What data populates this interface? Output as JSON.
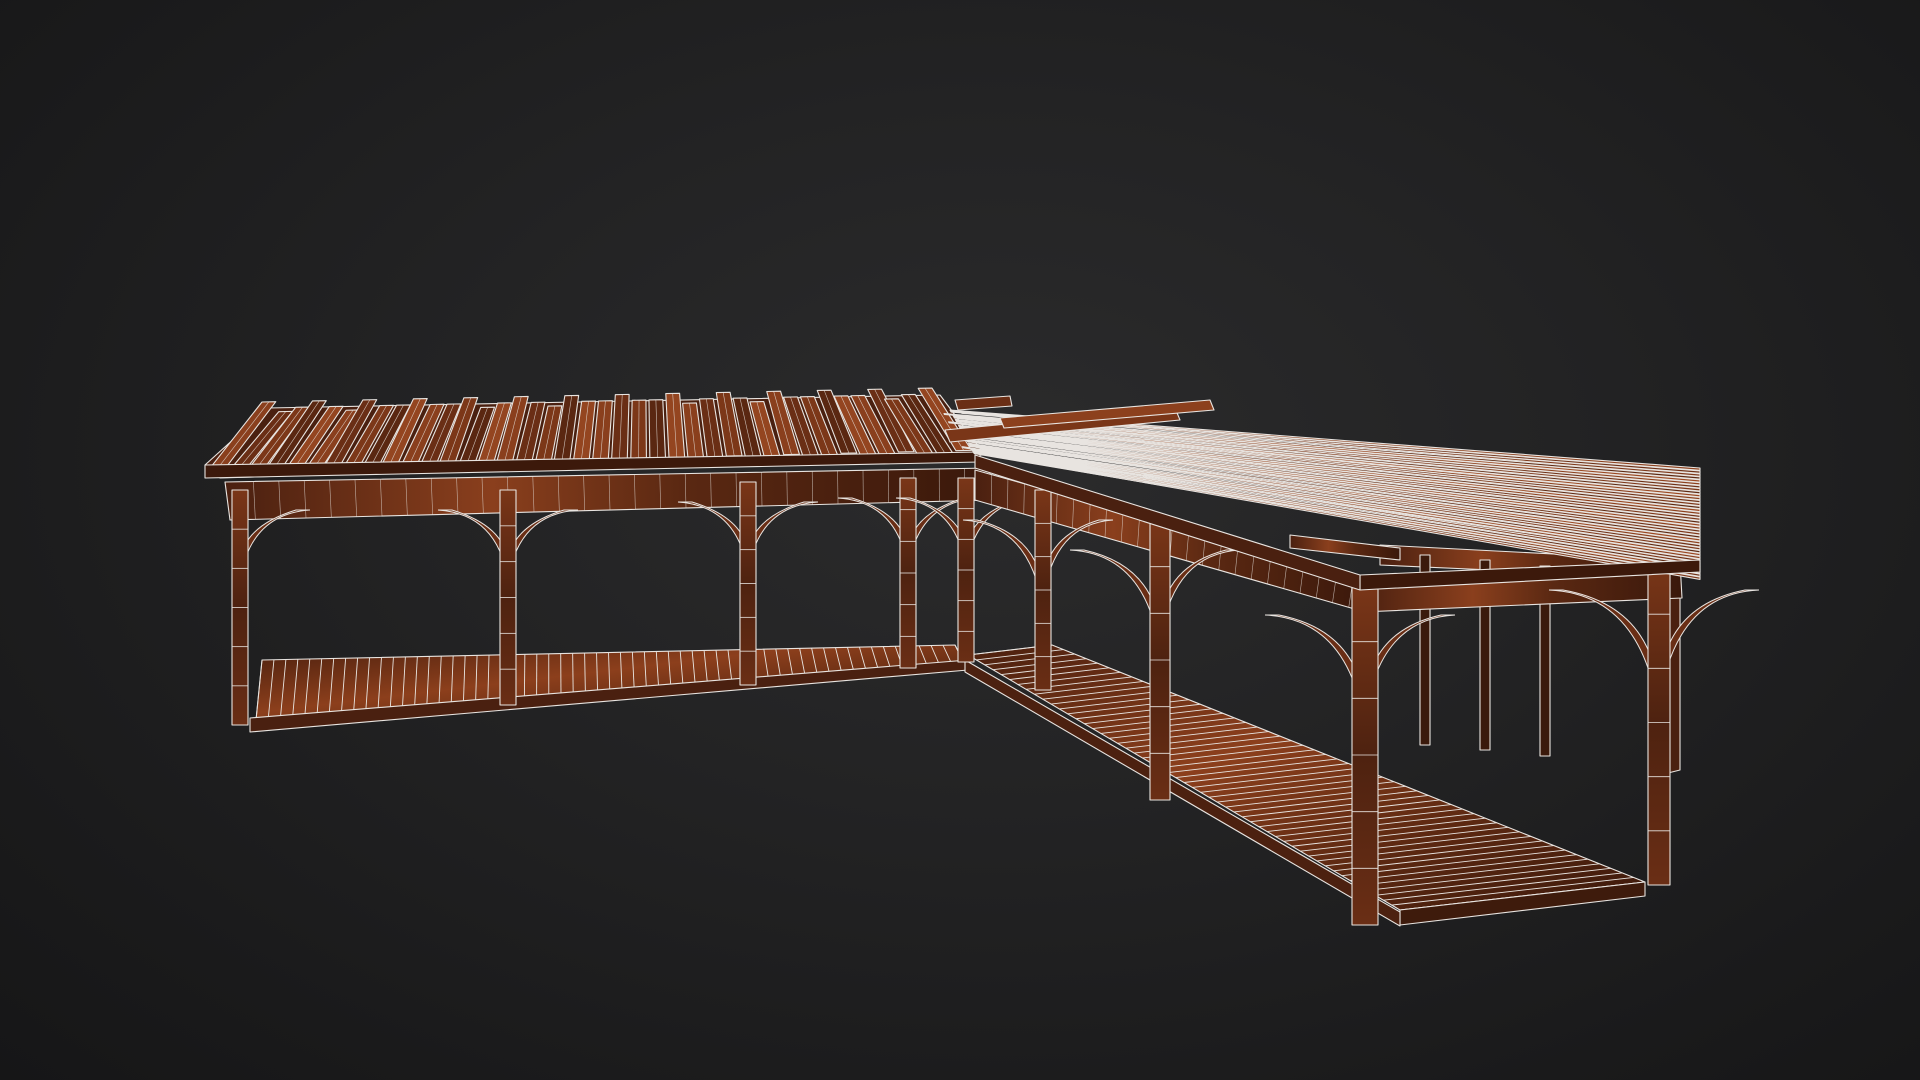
{
  "viewport": {
    "background": "#1c1c1d"
  },
  "model": {
    "render_style": "textured-wireframe",
    "wood_dark": "#3a1a0e",
    "wood_mid": "#6a2f17",
    "wood_light": "#a4532a",
    "wire": "#e8e4e0"
  }
}
